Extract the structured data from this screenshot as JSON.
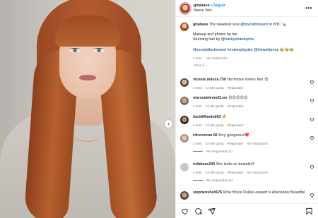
{
  "post": {
    "username": "gitabass",
    "follow_label": "Seguir",
    "separator": "•",
    "location": "Nueva York",
    "more_label": "•••",
    "next_label": "›"
  },
  "caption": {
    "username": "gitabass",
    "intro": "The sweetest soul",
    "mention1": "@brycedhoward",
    "after_mention1": "in NYC 🗽",
    "line2": "Makeup and photos by me",
    "line3_text": "Stunning hair by",
    "mention2": "@hairbyorlandopita",
    "hashtags": "#brycedallashoward #makeupbygita @thewallgroup",
    "emojis": "🐝🐝🐝",
    "time": "4 sem",
    "translate": "Ver traducción"
  },
  "pinned_label": "Para ti ⌄",
  "comments": [
    {
      "username": "vicente.deluca.750",
      "text": "Hermosa dame like 😍",
      "time": "4 sem",
      "likes": "14 Me gusta",
      "reply": "Responder",
      "translate": ""
    },
    {
      "username": "marcodelemo22.mr",
      "text": "😍😍😍😍😍",
      "time": "4 sem",
      "likes": "12 Me gusta",
      "reply": "Responder",
      "translate": ""
    },
    {
      "username": "hack84mehdi63",
      "text": "🔥",
      "time": "4 sem",
      "likes": "12 Me gusta",
      "reply": "Responder",
      "translate": ""
    },
    {
      "username": "efcorcoran.56",
      "text": "Hey gorgeous❤️",
      "time": "4 sem",
      "likes": "22 Me gusta",
      "reply": "Responder",
      "translate": "Ver traducción",
      "view_replies": "Ver respuestas (1)"
    },
    {
      "username": "ruthbass200",
      "text": "She looks so beautiful!!",
      "time": "4 sem",
      "likes": "13 Me gusta",
      "reply": "Responder",
      "translate": "Ver traducción",
      "view_replies": "Ver respuestas (1)"
    },
    {
      "username": "stephenshell676",
      "text": "Wow Bryce Dallas Howard is Absolutely Beautiful",
      "time": "",
      "likes": "",
      "reply": "",
      "translate": ""
    }
  ],
  "icons": {
    "like": "heart-icon",
    "comment": "comment-icon",
    "share": "share-icon",
    "save": "bookmark-icon"
  }
}
